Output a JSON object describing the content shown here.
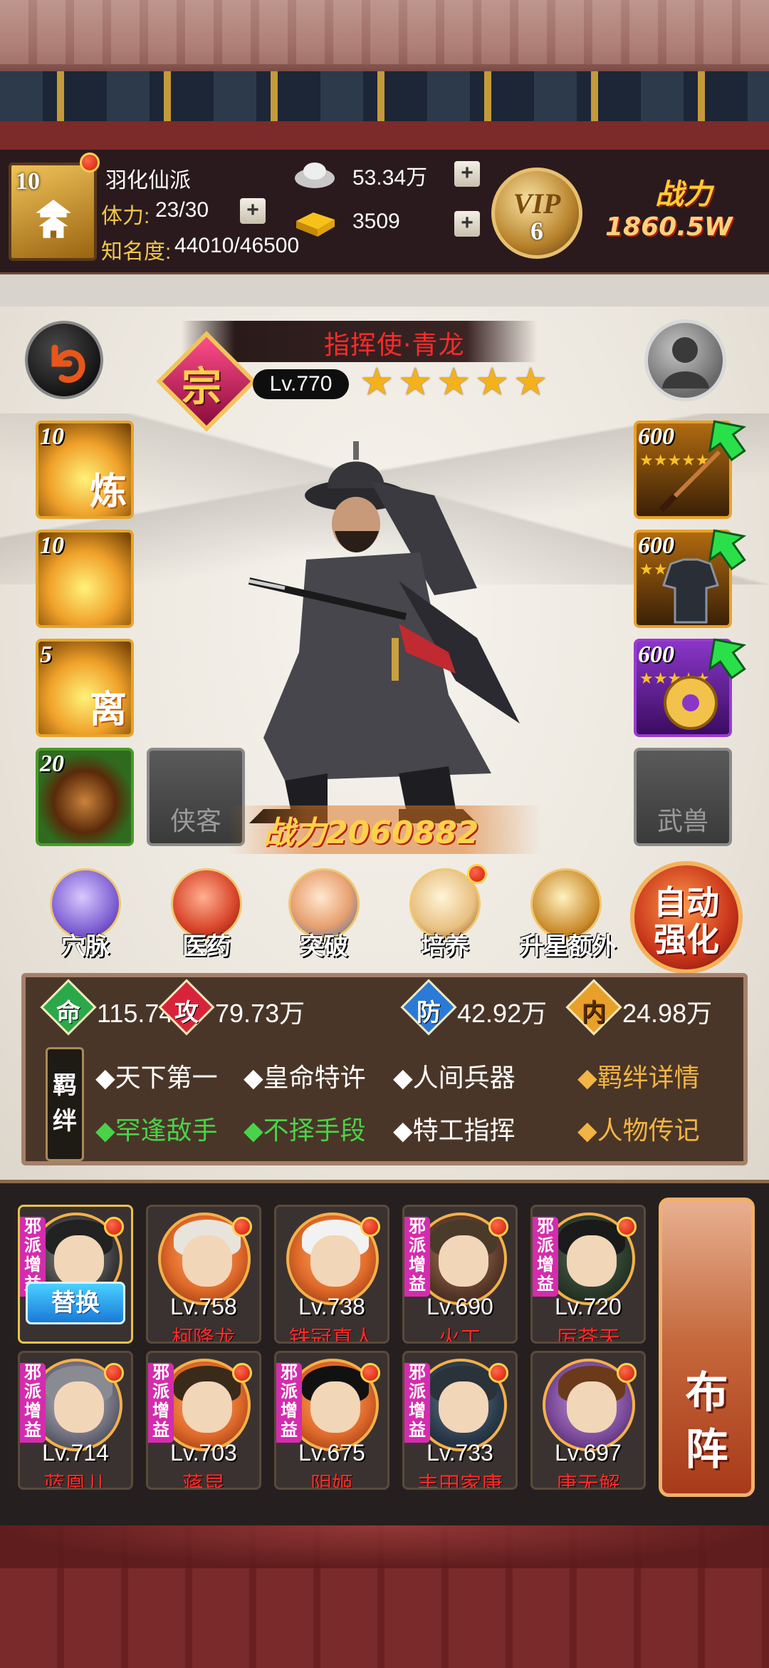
{
  "header": {
    "avatar_level": "10",
    "sect_name": "羽化仙派",
    "stamina_label": "体力:",
    "stamina_value": "23/30",
    "fame_label": "知名度:",
    "fame_value": "44010/46500",
    "silver": "53.34万",
    "gold": "3509",
    "vip_label": "VIP",
    "vip_level": "6",
    "power_label": "战力",
    "power_value": "1860.5W",
    "expand_icon": "chevron-up-icon"
  },
  "hero": {
    "grade_glyph": "宗",
    "name": "指挥使·青龙",
    "level": "Lv.770",
    "stars": 5,
    "combat_power": "战力2060882"
  },
  "skills_left": [
    {
      "level": "10",
      "glyph": "炼"
    },
    {
      "level": "10",
      "glyph": ""
    },
    {
      "level": "5",
      "glyph": "离"
    },
    {
      "level": "20",
      "glyph": ""
    }
  ],
  "slots": {
    "companion_label": "侠客",
    "beast_label": "武兽"
  },
  "equipment": [
    {
      "level": "600",
      "rarity": "orange"
    },
    {
      "level": "600",
      "rarity": "orange"
    },
    {
      "level": "600",
      "rarity": "purple"
    }
  ],
  "functions": [
    {
      "label": "穴脉"
    },
    {
      "label": "医药"
    },
    {
      "label": "突破"
    },
    {
      "label": "培养"
    },
    {
      "label": "升星额外"
    }
  ],
  "auto_strengthen": {
    "line1": "自动",
    "line2": "强化"
  },
  "stats": [
    {
      "glyph": "命",
      "value": "115.74万",
      "color": "#2aa84a"
    },
    {
      "glyph": "攻",
      "value": "79.73万",
      "color": "#d8243a"
    },
    {
      "glyph": "防",
      "value": "42.92万",
      "color": "#2a7ad8"
    },
    {
      "glyph": "内",
      "value": "24.98万",
      "color": "#e8a02a"
    }
  ],
  "bonds": {
    "tag_line1": "羁",
    "tag_line2": "绊",
    "row1": [
      "◆天下第一",
      "◆皇命特许",
      "◆人间兵器"
    ],
    "row2": [
      "◆罕逢敌手",
      "◆不择手段",
      "◆特工指挥"
    ],
    "detail_link": "◆羁绊详情",
    "bio_link": "◆人物传记"
  },
  "team": {
    "replace_label": "替换",
    "tag_text": "邪派增益",
    "members": [
      {
        "level": "",
        "name": "",
        "active": true
      },
      {
        "level": "Lv.758",
        "name": "柯降龙"
      },
      {
        "level": "Lv.738",
        "name": "铁冠真人"
      },
      {
        "level": "Lv.690",
        "name": "火工"
      },
      {
        "level": "Lv.720",
        "name": "厉苍天"
      },
      {
        "level": "Lv.714",
        "name": "蓝凰儿"
      },
      {
        "level": "Lv.703",
        "name": "蒋昆"
      },
      {
        "level": "Lv.675",
        "name": "阴姬"
      },
      {
        "level": "Lv.733",
        "name": "丰田家康"
      },
      {
        "level": "Lv.697",
        "name": "唐无解"
      }
    ],
    "formation_line1": "布",
    "formation_line2": "阵"
  }
}
